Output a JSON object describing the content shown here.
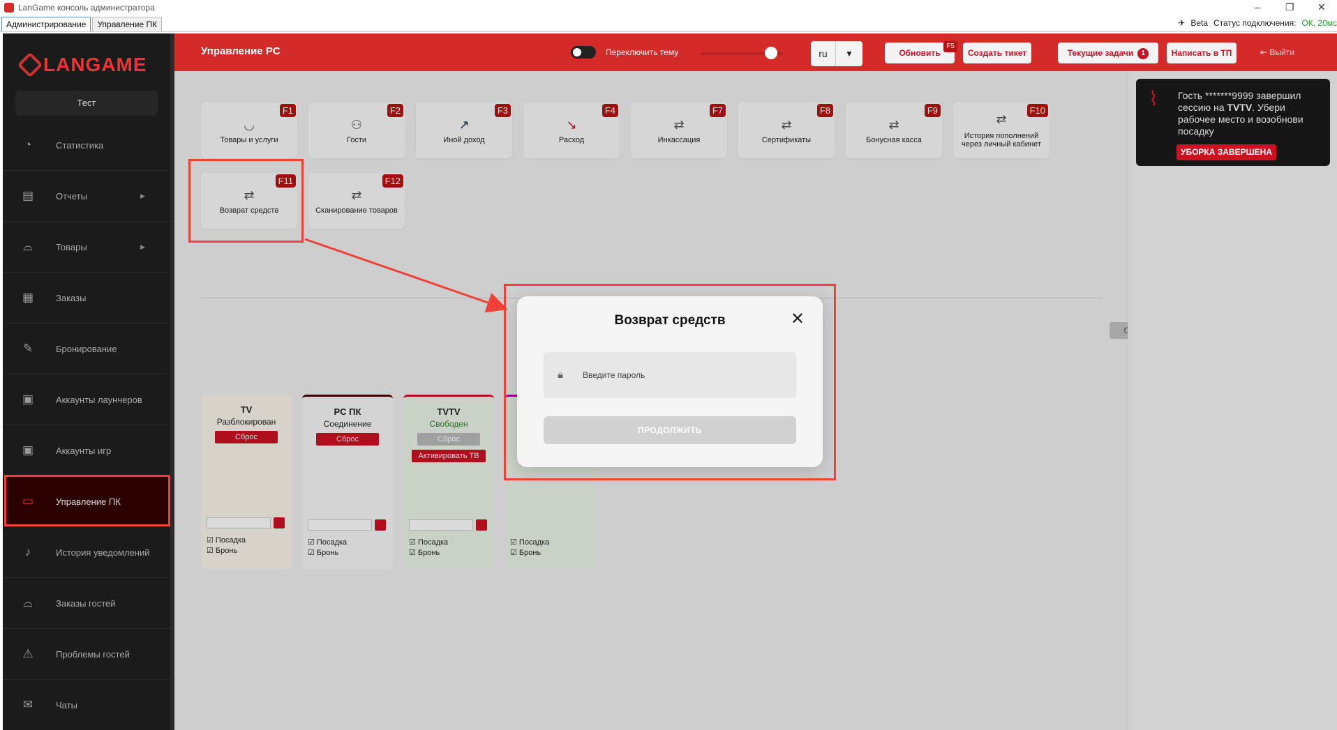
{
  "window": {
    "title": "LanGame консоль администратора",
    "tabs": [
      "Администрирование",
      "Управление ПК"
    ],
    "beta": "Beta",
    "status_label": "Статус подключения:",
    "status_value": "ОК, 20мс"
  },
  "sidebar": {
    "logo": "LANGAME",
    "profile": "Тест",
    "items": [
      {
        "label": "Статистика",
        "icon": "pie-chart-icon"
      },
      {
        "label": "Отчеты",
        "icon": "report-icon",
        "submenu": true
      },
      {
        "label": "Товары",
        "icon": "cloche-icon",
        "submenu": true
      },
      {
        "label": "Заказы",
        "icon": "grid-icon"
      },
      {
        "label": "Бронирование",
        "icon": "edit-icon"
      },
      {
        "label": "Аккаунты лаунчеров",
        "icon": "account-icon"
      },
      {
        "label": "Аккаунты игр",
        "icon": "account-icon"
      },
      {
        "label": "Управление ПК",
        "icon": "monitor-icon",
        "active": true
      },
      {
        "label": "История уведомлений",
        "icon": "bell-icon"
      },
      {
        "label": "Заказы гостей",
        "icon": "cloche-icon"
      },
      {
        "label": "Проблемы гостей",
        "icon": "warning-icon"
      },
      {
        "label": "Чаты",
        "icon": "chat-icon"
      }
    ]
  },
  "header": {
    "title": "Управление PC",
    "theme_toggle": "Переключить тему",
    "lang": "ru",
    "refresh": "Обновить",
    "refresh_key": "F5",
    "create_ticket": "Создать тикет",
    "current_tasks": "Текущие задачи",
    "tasks_count": "1",
    "write_support": "Написать в ТП",
    "logout": "Выйти"
  },
  "tiles": [
    {
      "label": "Товары и услуги",
      "key": "F1",
      "icon": "bowl-icon"
    },
    {
      "label": "Гости",
      "key": "F2",
      "icon": "users-icon"
    },
    {
      "label": "Иной доход",
      "key": "F3",
      "icon": "trend-up-icon"
    },
    {
      "label": "Расход",
      "key": "F4",
      "icon": "trend-down-icon"
    },
    {
      "label": "Инкассация",
      "key": "F7",
      "icon": "cash-exchange-icon"
    },
    {
      "label": "Сертификаты",
      "key": "F8",
      "icon": "cash-exchange-icon"
    },
    {
      "label": "Бонусная касса",
      "key": "F9",
      "icon": "cash-exchange-icon"
    },
    {
      "label": "История пополнений через личный кабинет",
      "key": "F10",
      "icon": "cash-exchange-icon"
    },
    {
      "label": "Возврат средств",
      "key": "F11",
      "icon": "cash-exchange-icon"
    },
    {
      "label": "Сканирование товаров",
      "key": "F12",
      "icon": "cash-exchange-icon"
    }
  ],
  "pc_controls": {
    "list_toggle": "Список ПК / Схема",
    "zoom_out": "−",
    "zoom_in": "+"
  },
  "pcs": [
    {
      "name": "TV",
      "state": "Разблокирован",
      "reset": "Сброс",
      "seat": "Посадка",
      "booking": "Бронь"
    },
    {
      "name": "PC ПК",
      "state": "Соединение",
      "reset": "Сброс",
      "seat": "Посадка",
      "booking": "Бронь"
    },
    {
      "name": "TVTV",
      "state": "Свободен",
      "reset": "Сброс",
      "activate": "Активировать ТВ",
      "seat": "Посадка",
      "booking": "Бронь"
    },
    {
      "name": "",
      "state": "",
      "seat": "Посадка",
      "booking": "Бронь"
    }
  ],
  "notification": {
    "text_1": "Гость *******9999 завершил сессию на ",
    "pc": "TVTV",
    "text_2": ". Убери рабочее место и возобнови посадку",
    "button": "УБОРКА ЗАВЕРШЕНА"
  },
  "modal": {
    "title": "Возврат средств",
    "password_placeholder": "Введите пароль",
    "continue": "ПРОДОЛЖИТЬ"
  },
  "colors": {
    "accent": "#d42a2a",
    "annotation": "#ef4137",
    "sidebar_bg": "#1b1b1b"
  }
}
